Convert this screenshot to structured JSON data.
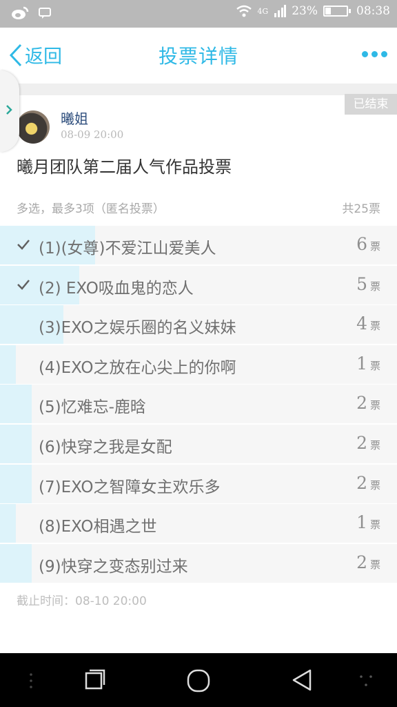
{
  "status_bar": {
    "network": "4G",
    "battery": "23%",
    "time": "08:38"
  },
  "header": {
    "back_label": "返回",
    "title": "投票详情"
  },
  "post": {
    "status_badge": "已结束",
    "author": "曦姐",
    "time": "08-09 20:00",
    "title": "曦月团队第二届人气作品投票",
    "meta": "多选，最多3项（匿名投票）",
    "total": "共25票"
  },
  "poll": {
    "unit": "票",
    "options": [
      {
        "label": "(1)(女尊)不爱江山爱美人",
        "votes": "6",
        "checked": true,
        "share": 0.24
      },
      {
        "label": "(2) EXO吸血鬼的恋人",
        "votes": "5",
        "checked": true,
        "share": 0.2
      },
      {
        "label": "(3)EXO之娱乐圈的名义妹妹",
        "votes": "4",
        "checked": false,
        "share": 0.16
      },
      {
        "label": "(4)EXO之放在心尖上的你啊",
        "votes": "1",
        "checked": false,
        "share": 0.04
      },
      {
        "label": "(5)忆难忘-鹿晗",
        "votes": "2",
        "checked": false,
        "share": 0.08
      },
      {
        "label": "(6)快穿之我是女配",
        "votes": "2",
        "checked": false,
        "share": 0.08
      },
      {
        "label": "(7)EXO之智障女主欢乐多",
        "votes": "2",
        "checked": false,
        "share": 0.08
      },
      {
        "label": "(8)EXO相遇之世",
        "votes": "1",
        "checked": false,
        "share": 0.04
      },
      {
        "label": "(9)快穿之变态别过来",
        "votes": "2",
        "checked": false,
        "share": 0.08
      }
    ]
  },
  "footer": {
    "deadline": "截止时间：08-10 20:00"
  },
  "colors": {
    "accent": "#2fb9e6",
    "bar": "#ddf3fa",
    "author": "#2d4d7c"
  },
  "icons": [
    "weibo-icon",
    "message-icon",
    "wifi-icon",
    "signal-icon",
    "battery-icon",
    "back-icon",
    "more-icon",
    "check-icon",
    "recent-apps-icon",
    "home-icon",
    "back-nav-icon"
  ]
}
